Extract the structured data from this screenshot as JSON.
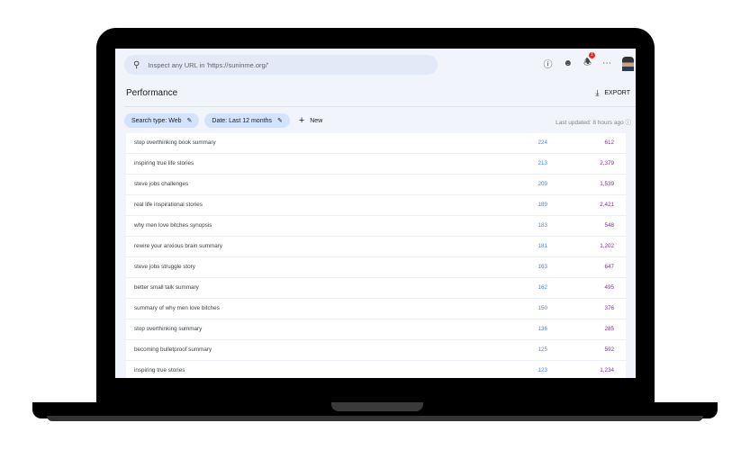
{
  "header": {
    "search_placeholder": "Inspect any URL in 'https://suninme.org/'",
    "notification_count": "1"
  },
  "page": {
    "title": "Performance",
    "export_label": "EXPORT",
    "filters": [
      {
        "label": "Search type: Web"
      },
      {
        "label": "Date: Last 12 months"
      }
    ],
    "new_label": "New",
    "last_updated": "Last updated: 8 hours ago"
  },
  "rows": [
    {
      "query": "stop overthinking book summary",
      "clicks": "224",
      "impressions": "612"
    },
    {
      "query": "inspiring true life stories",
      "clicks": "213",
      "impressions": "2,379"
    },
    {
      "query": "steve jobs challenges",
      "clicks": "209",
      "impressions": "1,539"
    },
    {
      "query": "real life inspirational stories",
      "clicks": "189",
      "impressions": "2,421"
    },
    {
      "query": "why men love bitches synopsis",
      "clicks": "183",
      "impressions": "548"
    },
    {
      "query": "rewire your anxious brain summary",
      "clicks": "181",
      "impressions": "1,202"
    },
    {
      "query": "steve jobs struggle story",
      "clicks": "163",
      "impressions": "647"
    },
    {
      "query": "better small talk summary",
      "clicks": "162",
      "impressions": "495"
    },
    {
      "query": "summary of why men love bitches",
      "clicks": "150",
      "impressions": "376"
    },
    {
      "query": "stop overthinking summary",
      "clicks": "136",
      "impressions": "285"
    },
    {
      "query": "becoming bulletproof summary",
      "clicks": "125",
      "impressions": "592"
    },
    {
      "query": "inspiring true stories",
      "clicks": "123",
      "impressions": "1,234"
    }
  ],
  "colors": {
    "clicks": "#4285f4",
    "impressions": "#7b2ea5",
    "chip": "#d3e3fd"
  }
}
